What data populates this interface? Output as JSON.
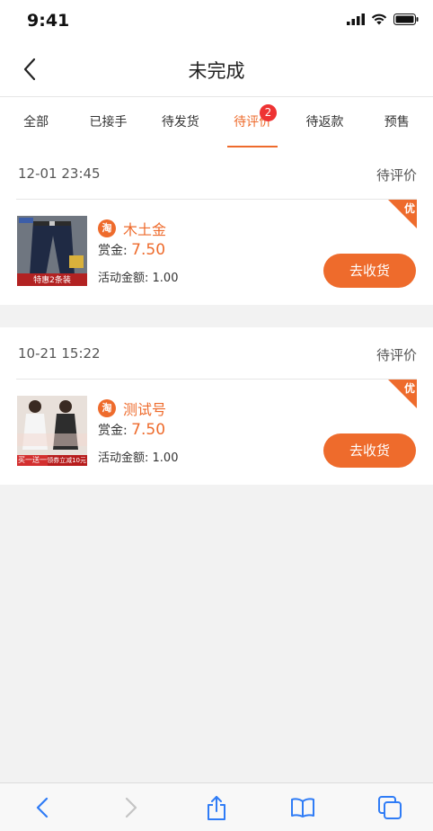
{
  "status_bar": {
    "time": "9:41"
  },
  "nav": {
    "title": "未完成"
  },
  "tabs": [
    {
      "label": "全部",
      "active": false
    },
    {
      "label": "已接手",
      "active": false
    },
    {
      "label": "待发货",
      "active": false
    },
    {
      "label": "待评价",
      "active": true,
      "badge": "2"
    },
    {
      "label": "待返款",
      "active": false
    },
    {
      "label": "预售",
      "active": false
    }
  ],
  "orders": [
    {
      "date": "12-01 23:45",
      "status": "待评价",
      "corner_badge": "优",
      "platform_icon": "淘",
      "shop_name": "木土金",
      "reward_label": "赏金:",
      "reward_amount": "7.50",
      "activity_label": "活动金额:",
      "activity_amount": "1.00",
      "action_label": "去收货",
      "thumb_caption": "特惠2条装"
    },
    {
      "date": "10-21 15:22",
      "status": "待评价",
      "corner_badge": "优",
      "platform_icon": "淘",
      "shop_name": "测试号",
      "reward_label": "赏金:",
      "reward_amount": "7.50",
      "activity_label": "活动金额:",
      "activity_amount": "1.00",
      "action_label": "去收货",
      "thumb_caption_left": "买一送一",
      "thumb_caption_right": "领券立减10元"
    }
  ],
  "colors": {
    "accent": "#ee6b2c",
    "badge": "#e33333"
  }
}
